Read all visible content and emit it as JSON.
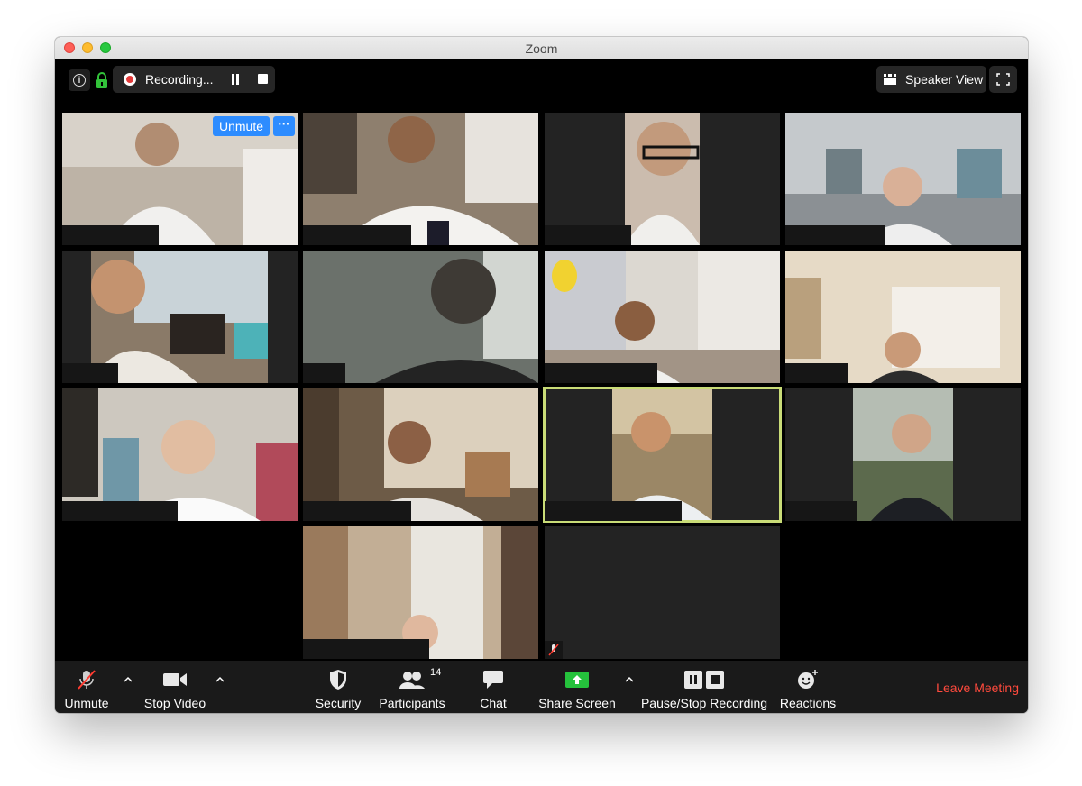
{
  "window": {
    "title": "Zoom"
  },
  "topbar": {
    "recording_label": "Recording...",
    "speaker_view_label": "Speaker View"
  },
  "grid": {
    "tiles": [
      {
        "id": 1,
        "colors": [
          "#9a8a78",
          "#c9bfb2",
          "#e6e2dc"
        ],
        "unmuted_prompt": true
      },
      {
        "id": 2,
        "colors": [
          "#6b5a48",
          "#b7a896",
          "#e9e5e0"
        ]
      },
      {
        "id": 3,
        "colors": [
          "#1e1e1e",
          "#b49a86",
          "#2a2a2a"
        ]
      },
      {
        "id": 4,
        "colors": [
          "#bfc3c6",
          "#a7adb2",
          "#6e7478"
        ]
      },
      {
        "id": 5,
        "colors": [
          "#3a3a3a",
          "#c9a686",
          "#7a6a58"
        ]
      },
      {
        "id": 6,
        "colors": [
          "#5e6560",
          "#8f958f",
          "#2c2c2c"
        ]
      },
      {
        "id": 7,
        "colors": [
          "#d9d4cc",
          "#b9aa98",
          "#8a7e70"
        ]
      },
      {
        "id": 8,
        "colors": [
          "#e3d7c4",
          "#cdbfae",
          "#9c8f80"
        ]
      },
      {
        "id": 9,
        "colors": [
          "#8d8b86",
          "#cfcac3",
          "#5d5852"
        ]
      },
      {
        "id": 10,
        "colors": [
          "#5a4a3a",
          "#b6a68e",
          "#e3dbcf"
        ]
      },
      {
        "id": 11,
        "colors": [
          "#262626",
          "#9e8868",
          "#2a2a2a"
        ],
        "active": true
      },
      {
        "id": 12,
        "colors": [
          "#232323",
          "#6d7a66",
          "#1f1f1f"
        ]
      },
      {
        "id": 13,
        "colors": [
          "#7a6250",
          "#c9b59c",
          "#e2d8c8"
        ]
      },
      {
        "id": 14,
        "colors": [
          "#232323",
          "#232323",
          "#232323"
        ],
        "muted": true
      }
    ],
    "unmute_label": "Unmute",
    "more_label": "···"
  },
  "toolbar": {
    "unmute_label": "Unmute",
    "stop_video_label": "Stop Video",
    "security_label": "Security",
    "participants_label": "Participants",
    "participants_count": "14",
    "chat_label": "Chat",
    "share_screen_label": "Share Screen",
    "pause_stop_label": "Pause/Stop Recording",
    "reactions_label": "Reactions",
    "leave_label": "Leave Meeting"
  },
  "colors": {
    "accent_blue": "#2d8cff",
    "leave_red": "#ff4a3d",
    "share_green": "#25c23c",
    "active_speaker": "#c9dc77"
  }
}
